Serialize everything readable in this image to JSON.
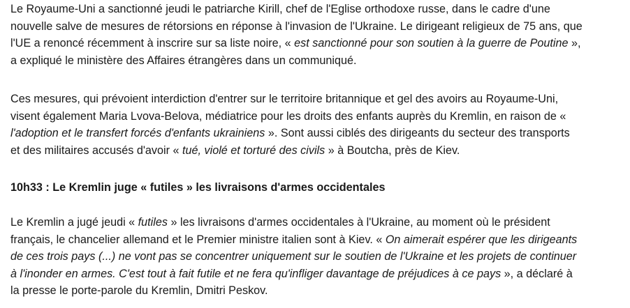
{
  "article": {
    "p1": [
      [
        "Le Royaume-Uni a sanctionné jeudi le patriarche Kirill, chef de l'Eglise orthodoxe russe, dans le cadre d'une",
        "",
        ""
      ],
      [
        "nouvelle salve de mesures de rétorsions en réponse à l'invasion de l'Ukraine. Le dirigeant religieux de 75 ans, que",
        "",
        ""
      ],
      [
        "l'UE a renoncé récemment à inscrire sur sa liste noire, « ",
        "est sanctionné pour son soutien à la guerre de Poutine",
        " »,"
      ],
      [
        "a expliqué le ministère des Affaires étrangères dans un communiqué.",
        "",
        ""
      ]
    ],
    "p2": [
      [
        "Ces mesures, qui prévoient interdiction d'entrer sur le territoire britannique et gel des avoirs au Royaume-Uni,",
        "",
        ""
      ],
      [
        "visent également Maria Lvova-Belova, médiatrice pour les droits des enfants auprès du Kremlin, en raison de «",
        "",
        ""
      ],
      [
        "",
        "l'adoption et le transfert forcés d'enfants ukrainiens",
        " ». Sont aussi ciblés des dirigeants du secteur des transports"
      ],
      [
        "et des militaires accusés d'avoir « ",
        "tué, violé et torturé des civils",
        " » à Boutcha, près de Kiev."
      ]
    ],
    "heading": "10h33 : Le Kremlin juge « futiles » les livraisons d'armes occidentales",
    "p3": [
      [
        "Le Kremlin a jugé jeudi « ",
        "futiles",
        " » les livraisons d'armes occidentales à l'Ukraine, au moment où le président"
      ],
      [
        "français, le chancelier allemand et le Premier ministre italien sont à Kiev. « ",
        "On aimerait espérer que les dirigeants",
        ""
      ],
      [
        "",
        "de ces trois pays (...) ne vont pas se concentrer uniquement sur le soutien de l'Ukraine et les projets de continuer",
        ""
      ],
      [
        "",
        "à l'inonder en armes. C'est tout à fait futile et ne fera qu'infliger davantage de préjudices à ce pays",
        " », a déclaré à"
      ],
      [
        "la presse le porte-parole du Kremlin, Dmitri Peskov.",
        "",
        ""
      ]
    ]
  }
}
